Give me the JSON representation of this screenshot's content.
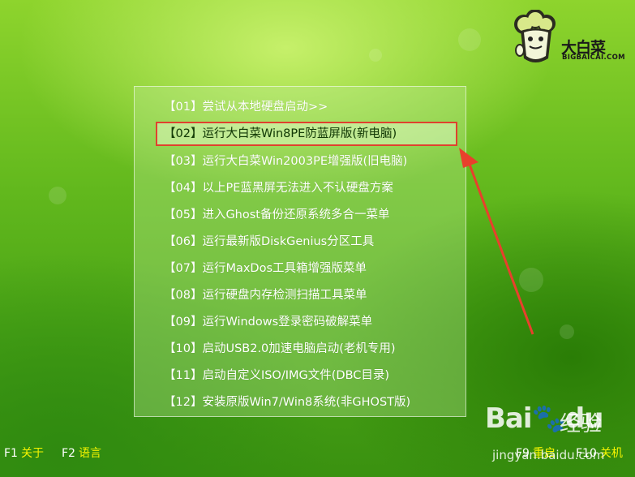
{
  "logo": {
    "name": "大白菜",
    "sub": "BIGBAICAI.COM"
  },
  "menu": {
    "selected_index": 1,
    "items": [
      {
        "label": "【01】尝试从本地硬盘启动>>"
      },
      {
        "label": "【02】运行大白菜Win8PE防蓝屏版(新电脑)"
      },
      {
        "label": "【03】运行大白菜Win2003PE增强版(旧电脑)"
      },
      {
        "label": "【04】以上PE蓝黑屏无法进入不认硬盘方案"
      },
      {
        "label": "【05】进入Ghost备份还原系统多合一菜单"
      },
      {
        "label": "【06】运行最新版DiskGenius分区工具"
      },
      {
        "label": "【07】运行MaxDos工具箱增强版菜单"
      },
      {
        "label": "【08】运行硬盘内存检测扫描工具菜单"
      },
      {
        "label": "【09】运行Windows登录密码破解菜单"
      },
      {
        "label": "【10】启动USB2.0加速电脑启动(老机专用)"
      },
      {
        "label": "【11】启动自定义ISO/IMG文件(DBC目录)"
      },
      {
        "label": "【12】安装原版Win7/Win8系统(非GHOST版)"
      }
    ]
  },
  "footer": {
    "f1_key": "F1",
    "f1_label": "关于",
    "f2_key": "F2",
    "f2_label": "语言",
    "f9_key": "F9",
    "f9_label": "重启",
    "f10_key": "F10",
    "f10_label": "关机"
  },
  "watermark": {
    "brand": "Bai",
    "brand2": "du",
    "product": "经验",
    "url": "jingyan.baidu.com"
  },
  "colors": {
    "highlight_border": "#e0412e",
    "arrow": "#e8402c",
    "label_yellow": "#f7f500"
  }
}
